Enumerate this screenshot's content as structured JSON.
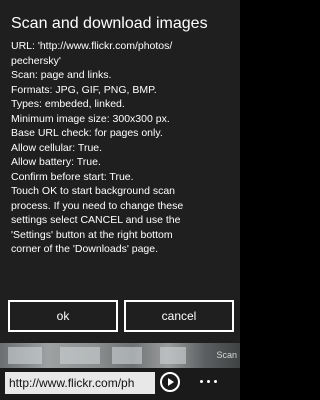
{
  "dialog": {
    "title": "Scan and download images",
    "lines": [
      "URL: 'http://www.flickr.com/photos/",
      "pechersky'",
      "Scan: page and links.",
      "Formats: JPG, GIF, PNG, BMP.",
      "Types: embeded, linked.",
      "Minimum image size: 300x300 px.",
      "Base URL check: for pages only.",
      "Allow cellular: True.",
      "Allow battery: True.",
      "Confirm before start: True.",
      "Touch OK to start background scan",
      "process. If you need to change these",
      "settings select CANCEL and use the",
      "'Settings' button at the right bottom",
      "corner of the 'Downloads' page."
    ],
    "ok_label": "ok",
    "cancel_label": "cancel"
  },
  "background": {
    "scan_label": "Scan"
  },
  "appbar": {
    "address_value": "http://www.flickr.com/ph",
    "go_icon": "arrow-right-icon",
    "more_icon": "ellipsis-icon"
  },
  "colors": {
    "dialog_background": "#1f1f1f",
    "text": "#ffffff",
    "address_bar_background": "#e8e8e8"
  }
}
